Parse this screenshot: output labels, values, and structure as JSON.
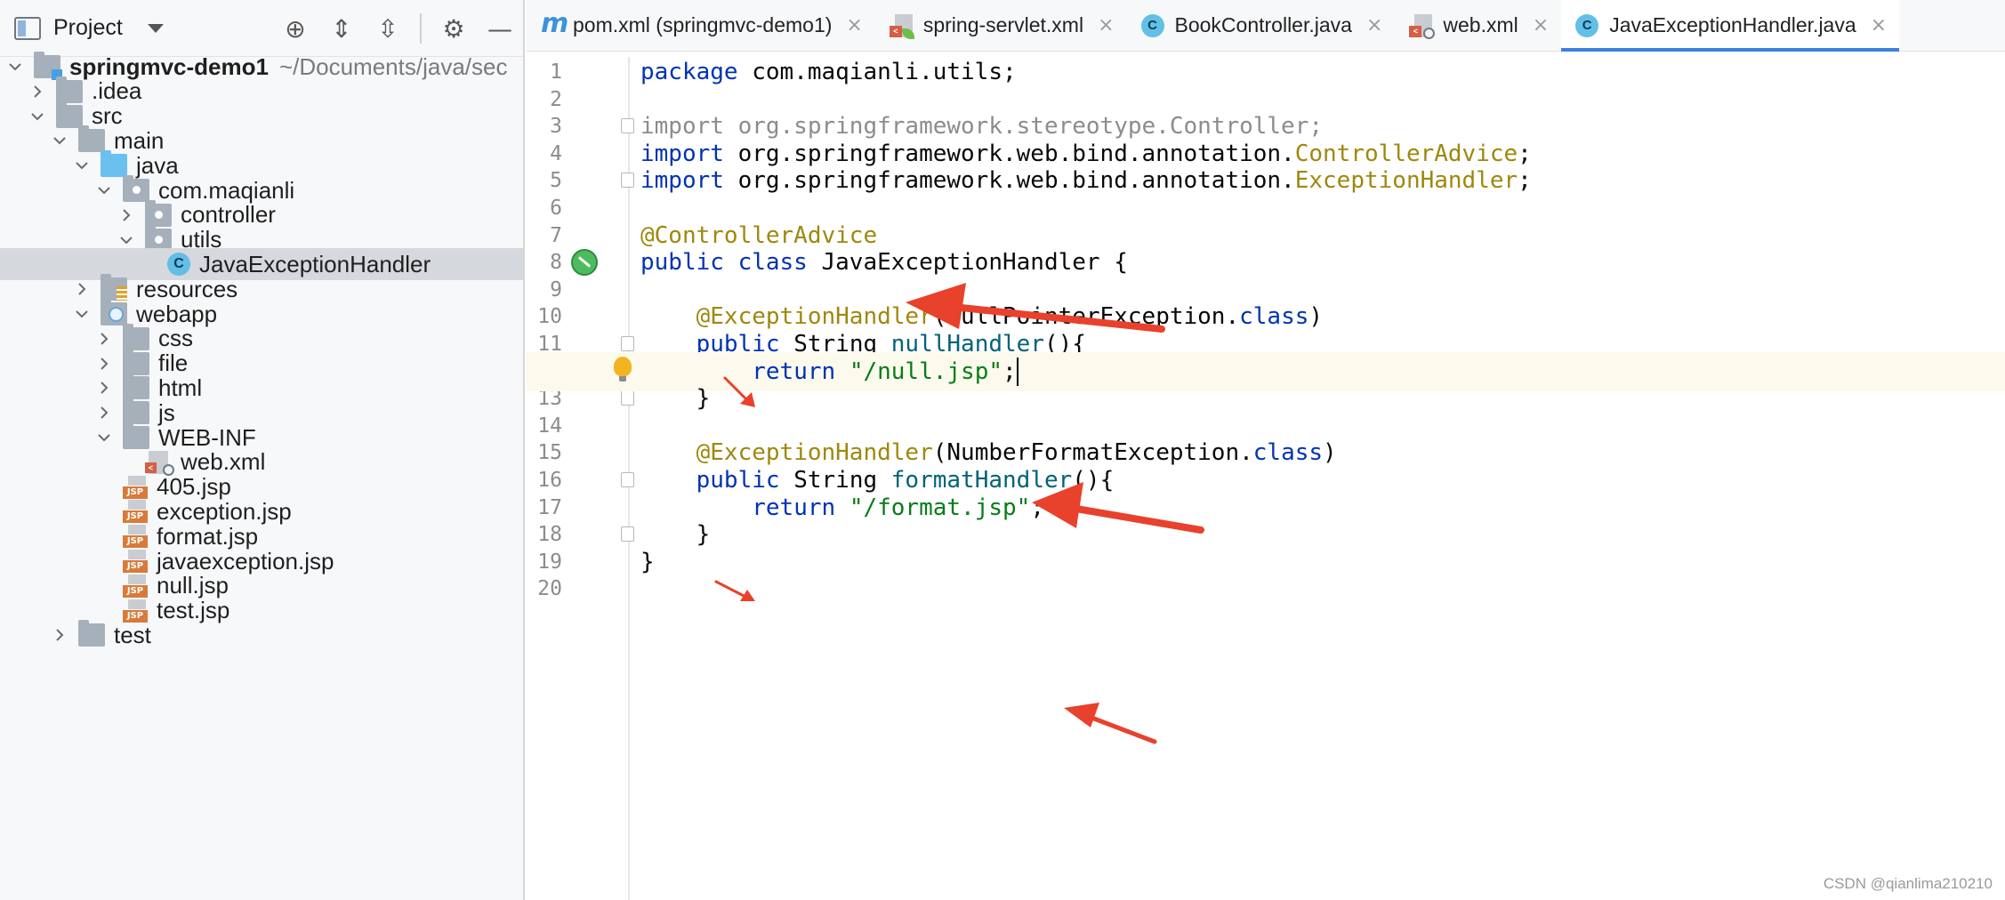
{
  "project_panel": {
    "title": "Project",
    "tree": [
      {
        "label": "springmvc-demo1",
        "extra": "~/Documents/java/sec",
        "icon": "module",
        "depth": 0,
        "chevron": "down"
      },
      {
        "label": ".idea",
        "icon": "folder",
        "depth": 1,
        "chevron": "right"
      },
      {
        "label": "src",
        "icon": "folder",
        "depth": 1,
        "chevron": "down"
      },
      {
        "label": "main",
        "icon": "folder",
        "depth": 2,
        "chevron": "down"
      },
      {
        "label": "java",
        "icon": "src-folder",
        "depth": 3,
        "chevron": "down"
      },
      {
        "label": "com.maqianli",
        "icon": "package",
        "depth": 4,
        "chevron": "down"
      },
      {
        "label": "controller",
        "icon": "package",
        "depth": 5,
        "chevron": "right"
      },
      {
        "label": "utils",
        "icon": "package",
        "depth": 5,
        "chevron": "down"
      },
      {
        "label": "JavaExceptionHandler",
        "icon": "class",
        "depth": 6,
        "chevron": "none",
        "selected": true
      },
      {
        "label": "resources",
        "icon": "resources-folder",
        "depth": 3,
        "chevron": "right"
      },
      {
        "label": "webapp",
        "icon": "web-folder",
        "depth": 3,
        "chevron": "down"
      },
      {
        "label": "css",
        "icon": "folder",
        "depth": 4,
        "chevron": "right"
      },
      {
        "label": "file",
        "icon": "folder",
        "depth": 4,
        "chevron": "right"
      },
      {
        "label": "html",
        "icon": "folder",
        "depth": 4,
        "chevron": "right"
      },
      {
        "label": "js",
        "icon": "folder",
        "depth": 4,
        "chevron": "right"
      },
      {
        "label": "WEB-INF",
        "icon": "folder",
        "depth": 4,
        "chevron": "down"
      },
      {
        "label": "web.xml",
        "icon": "xml",
        "depth": 5,
        "chevron": "none"
      },
      {
        "label": "405.jsp",
        "icon": "jsp",
        "depth": 4,
        "chevron": "none"
      },
      {
        "label": "exception.jsp",
        "icon": "jsp",
        "depth": 4,
        "chevron": "none"
      },
      {
        "label": "format.jsp",
        "icon": "jsp",
        "depth": 4,
        "chevron": "none"
      },
      {
        "label": "javaexception.jsp",
        "icon": "jsp",
        "depth": 4,
        "chevron": "none"
      },
      {
        "label": "null.jsp",
        "icon": "jsp",
        "depth": 4,
        "chevron": "none"
      },
      {
        "label": "test.jsp",
        "icon": "jsp",
        "depth": 4,
        "chevron": "none"
      },
      {
        "label": "test",
        "icon": "folder",
        "depth": 2,
        "chevron": "right"
      }
    ]
  },
  "tabs": [
    {
      "label": "pom.xml (springmvc-demo1)",
      "icon": "maven-icon"
    },
    {
      "label": "spring-servlet.xml",
      "icon": "spring-xml-icon"
    },
    {
      "label": "BookController.java",
      "icon": "class-icon"
    },
    {
      "label": "web.xml",
      "icon": "web-xml-icon"
    },
    {
      "label": "JavaExceptionHandler.java",
      "icon": "class-icon",
      "active": true
    }
  ],
  "editor": {
    "current_line": 12,
    "lines": [
      [
        [
          "kw",
          "package"
        ],
        [
          "t",
          " com.maqianli.utils;"
        ]
      ],
      [],
      [
        [
          "imp",
          "import org.springframework.stereotype.Controller;"
        ]
      ],
      [
        [
          "kw",
          "import"
        ],
        [
          "t",
          " org.springframework.web.bind.annotation."
        ],
        [
          "ann",
          "ControllerAdvice"
        ],
        [
          "t",
          ";"
        ]
      ],
      [
        [
          "kw",
          "import"
        ],
        [
          "t",
          " org.springframework.web.bind.annotation."
        ],
        [
          "ann",
          "ExceptionHandler"
        ],
        [
          "t",
          ";"
        ]
      ],
      [],
      [
        [
          "ann",
          "@ControllerAdvice"
        ]
      ],
      [
        [
          "kw",
          "public class"
        ],
        [
          "t",
          " JavaExceptionHandler {"
        ]
      ],
      [],
      [
        [
          "t",
          "    "
        ],
        [
          "ann",
          "@ExceptionHandler"
        ],
        [
          "t",
          "(NullPointerException."
        ],
        [
          "kw",
          "class"
        ],
        [
          "t",
          ")"
        ]
      ],
      [
        [
          "t",
          "    "
        ],
        [
          "kw",
          "public"
        ],
        [
          "t",
          " String "
        ],
        [
          "meth",
          "nullHandler"
        ],
        [
          "t",
          "(){"
        ]
      ],
      [
        [
          "t",
          "        "
        ],
        [
          "kw",
          "return"
        ],
        [
          "t",
          " "
        ],
        [
          "str",
          "\"/null.jsp\""
        ],
        [
          "t",
          ";"
        ],
        [
          "cursor",
          ""
        ]
      ],
      [
        [
          "t",
          "    }"
        ]
      ],
      [],
      [
        [
          "t",
          "    "
        ],
        [
          "ann",
          "@ExceptionHandler"
        ],
        [
          "t",
          "(NumberFormatException."
        ],
        [
          "kw",
          "class"
        ],
        [
          "t",
          ")"
        ]
      ],
      [
        [
          "t",
          "    "
        ],
        [
          "kw",
          "public"
        ],
        [
          "t",
          " String "
        ],
        [
          "meth",
          "formatHandler"
        ],
        [
          "t",
          "(){"
        ]
      ],
      [
        [
          "t",
          "        "
        ],
        [
          "kw",
          "return"
        ],
        [
          "t",
          " "
        ],
        [
          "str",
          "\"/format.jsp\""
        ],
        [
          "t",
          ";"
        ]
      ],
      [
        [
          "t",
          "    }"
        ]
      ],
      [
        [
          "t",
          "}"
        ]
      ],
      []
    ],
    "fold_markers": [
      3,
      5,
      11,
      13,
      16,
      18
    ],
    "gutter_icons": {
      "run_line": 8,
      "bulb_line": 12
    }
  },
  "watermark": "CSDN @qianlima210210",
  "colors": {
    "arrow": "#e8412c",
    "keyword": "#0033b3",
    "annotation": "#9e880d",
    "string": "#067d17",
    "method": "#00627a",
    "import_unused": "#8c8c8c",
    "active_tab_underline": "#3b7fe0",
    "selection": "#d5d8dd"
  }
}
